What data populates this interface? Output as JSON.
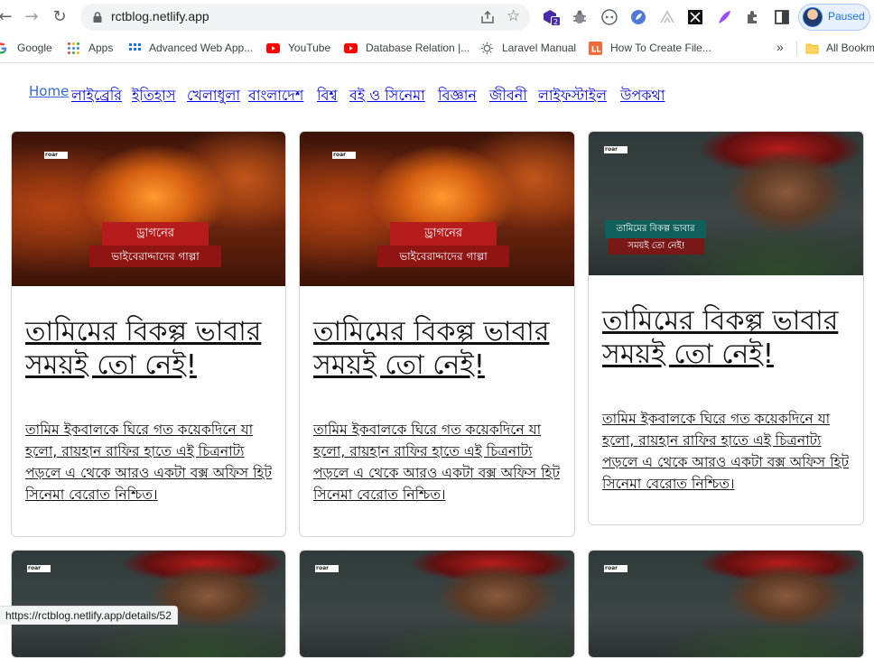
{
  "browser": {
    "url": "rctblog.netlify.app",
    "profile_status": "Paused",
    "extension_badge": "2"
  },
  "bookmarks": [
    {
      "label": "Google",
      "icon": "google-icon"
    },
    {
      "label": "Apps",
      "icon": "apps-grid-icon"
    },
    {
      "label": "Advanced Web App...",
      "icon": "page-icon"
    },
    {
      "label": "YouTube",
      "icon": "youtube-icon"
    },
    {
      "label": "Database Relation |...",
      "icon": "youtube-icon"
    },
    {
      "label": "Laravel Manual",
      "icon": "sun-icon"
    },
    {
      "label": "How To Create File...",
      "icon": "ll-icon"
    }
  ],
  "bookmarks_more": "»",
  "bookmarks_all": "All Bookm",
  "nav": {
    "home": "Home",
    "items": [
      "লাইব্রেরি",
      "ইতিহাস",
      "খেলাধুলা",
      "বাংলাদেশ",
      "বিশ্ব",
      "বই ও সিনেমা",
      "বিজ্ঞান",
      "জীবনী",
      "লাইফস্টাইল",
      "উপকথা"
    ]
  },
  "cards": [
    {
      "image": "dragon",
      "image_brand": "roar",
      "image_caption_line1": "ড্রাগনের",
      "image_caption_line2": "ভাইবেরাদ্দাদের গাল্পা",
      "title": "তামিমের বিকল্প ভাবার সময়ই তো নেই!",
      "excerpt": "তামিম ইকবালকে ঘিরে গত কয়েকদিনে যা হলো, রায়হান রাফির হাতে এই চিত্রনাট্য পড়লে এ থেকে আরও একটা বক্স অফিস হিট সিনেমা বেরোত নিশ্চিত।"
    },
    {
      "image": "dragon",
      "image_brand": "roar",
      "image_caption_line1": "ড্রাগনের",
      "image_caption_line2": "ভাইবেরাদ্দাদের গাল্পা",
      "title": "তামিমের বিকল্প ভাবার সময়ই তো নেই!",
      "excerpt": "তামিম ইকবালকে ঘিরে গত কয়েকদিনে যা হলো, রায়হান রাফির হাতে এই চিত্রনাট্য পড়লে এ থেকে আরও একটা বক্স অফিস হিট সিনেমা বেরোত নিশ্চিত।"
    },
    {
      "image": "tamim",
      "image_brand": "roar",
      "image_caption_line1": "তামিমের বিকল্প ভাবার",
      "image_caption_line2": "সময়ই তো নেই!",
      "title": "তামিমের বিকল্প ভাবার সময়ই তো নেই!",
      "excerpt": "তামিম ইকবালকে ঘিরে গত কয়েকদিনে যা হলো, রায়হান রাফির হাতে এই চিত্রনাট্য পড়লে এ থেকে আরও একটা বক্স অফিস হিট সিনেমা বেরোত নিশ্চিত।"
    }
  ],
  "status_bar": "https://rctblog.netlify.app/details/52"
}
